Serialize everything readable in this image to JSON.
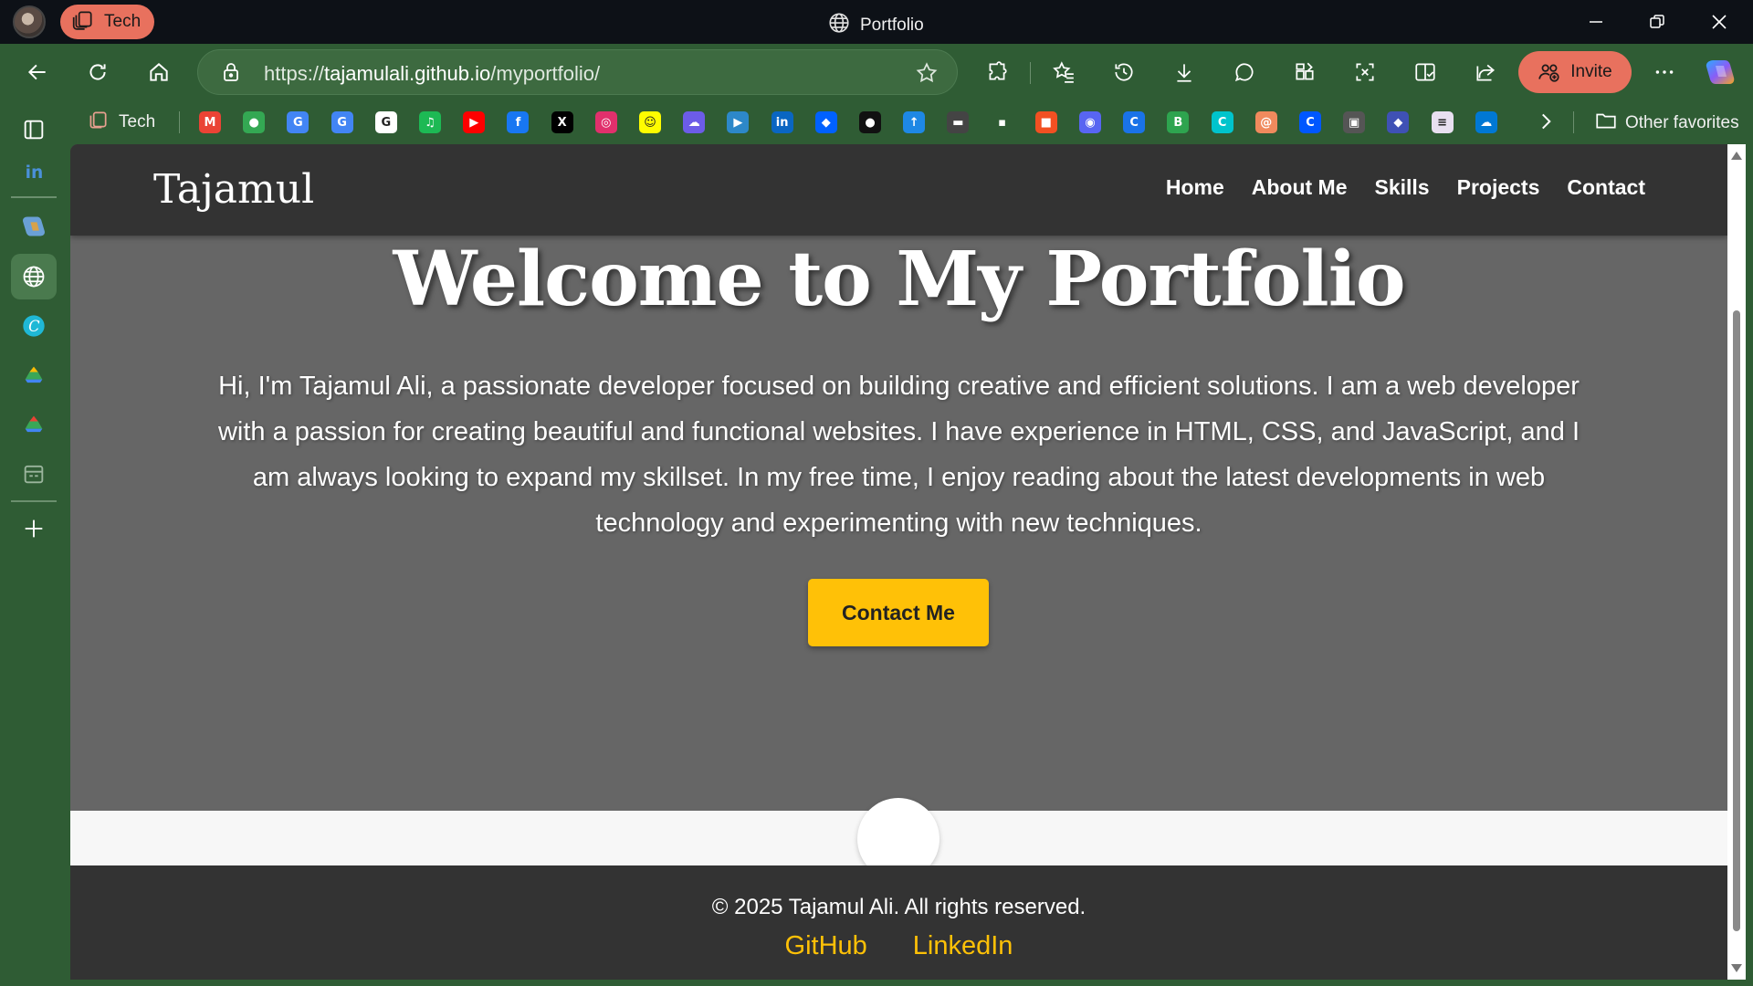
{
  "colors": {
    "browser_chrome": "#2f5c34",
    "titlebar": "#0d1117",
    "accent_pill": "#e8715e",
    "site_dark": "#333333",
    "site_hero": "#666666",
    "site_accent": "#ffc107"
  },
  "browser": {
    "workspace_label": "Tech",
    "tab_title": "Portfolio",
    "url_prefix": "https://",
    "url_domain": "tajamulali.github.io",
    "url_path": "/myportfolio/",
    "invite_label": "Invite",
    "favorites_folder": "Tech",
    "other_favorites": "Other favorites",
    "favorites": [
      {
        "icon": "gmail-icon",
        "glyph": "M",
        "color": "#ea4335"
      },
      {
        "icon": "maps-icon",
        "glyph": "●",
        "color": "#34a853"
      },
      {
        "icon": "calendar-icon",
        "glyph": "G",
        "color": "#4285f4"
      },
      {
        "icon": "translate-icon",
        "glyph": "G",
        "color": "#4285f4"
      },
      {
        "icon": "google-icon",
        "glyph": "G",
        "color": "#ffffff"
      },
      {
        "icon": "spotify-icon",
        "glyph": "♫",
        "color": "#1db954"
      },
      {
        "icon": "youtube-icon",
        "glyph": "▶",
        "color": "#ff0000"
      },
      {
        "icon": "facebook-icon",
        "glyph": "f",
        "color": "#1877f2"
      },
      {
        "icon": "x-icon",
        "glyph": "X",
        "color": "#000000"
      },
      {
        "icon": "instagram-icon",
        "glyph": "◎",
        "color": "#e1306c"
      },
      {
        "icon": "snapchat-icon",
        "glyph": "☺",
        "color": "#fffc00"
      },
      {
        "icon": "cloud-app-icon",
        "glyph": "☁",
        "color": "#6c5ce7"
      },
      {
        "icon": "video-icon",
        "glyph": "▶",
        "color": "#2d88c9"
      },
      {
        "icon": "linkedin-icon",
        "glyph": "in",
        "color": "#0a66c2"
      },
      {
        "icon": "dropbox-icon",
        "glyph": "◆",
        "color": "#0061ff"
      },
      {
        "icon": "github-icon",
        "glyph": "●",
        "color": "#111111"
      },
      {
        "icon": "upload-icon",
        "glyph": "↑",
        "color": "#1e88e5"
      },
      {
        "icon": "terminal-icon",
        "glyph": "▬",
        "color": "#444444"
      },
      {
        "icon": "figure-icon",
        "glyph": "▪",
        "color": "#2f5c34"
      },
      {
        "icon": "microsoft-icon",
        "glyph": "■",
        "color": "#f25022"
      },
      {
        "icon": "discord-icon",
        "glyph": "◉",
        "color": "#5865f2"
      },
      {
        "icon": "chrome-app-icon",
        "glyph": "C",
        "color": "#1a73e8"
      },
      {
        "icon": "b-app-icon",
        "glyph": "B",
        "color": "#2ea44f"
      },
      {
        "icon": "canva-icon",
        "glyph": "C",
        "color": "#00c4cc"
      },
      {
        "icon": "swirl-icon",
        "glyph": "@",
        "color": "#f08a5d"
      },
      {
        "icon": "c-app-icon",
        "glyph": "C",
        "color": "#0057ff"
      },
      {
        "icon": "game-icon",
        "glyph": "▣",
        "color": "#555555"
      },
      {
        "icon": "gem-icon",
        "glyph": "◆",
        "color": "#3f51b5"
      },
      {
        "icon": "doc-app-icon",
        "glyph": "≡",
        "color": "#e8e0f0"
      },
      {
        "icon": "onedrive-icon",
        "glyph": "☁",
        "color": "#0078d4"
      }
    ]
  },
  "site": {
    "logo": "Tajamul",
    "nav": [
      "Home",
      "About Me",
      "Skills",
      "Projects",
      "Contact"
    ],
    "hero_title": "Welcome to My Portfolio",
    "hero_text": "Hi, I'm Tajamul Ali, a passionate developer focused on building creative and efficient solutions. I am a web developer with a passion for creating beautiful and functional websites. I have experience in HTML, CSS, and JavaScript, and I am always looking to expand my skillset. In my free time, I enjoy reading about the latest developments in web technology and experimenting with new techniques.",
    "cta_label": "Contact Me",
    "copyright": "© 2025 Tajamul Ali. All rights reserved.",
    "footer_links": [
      "GitHub",
      "LinkedIn"
    ]
  }
}
